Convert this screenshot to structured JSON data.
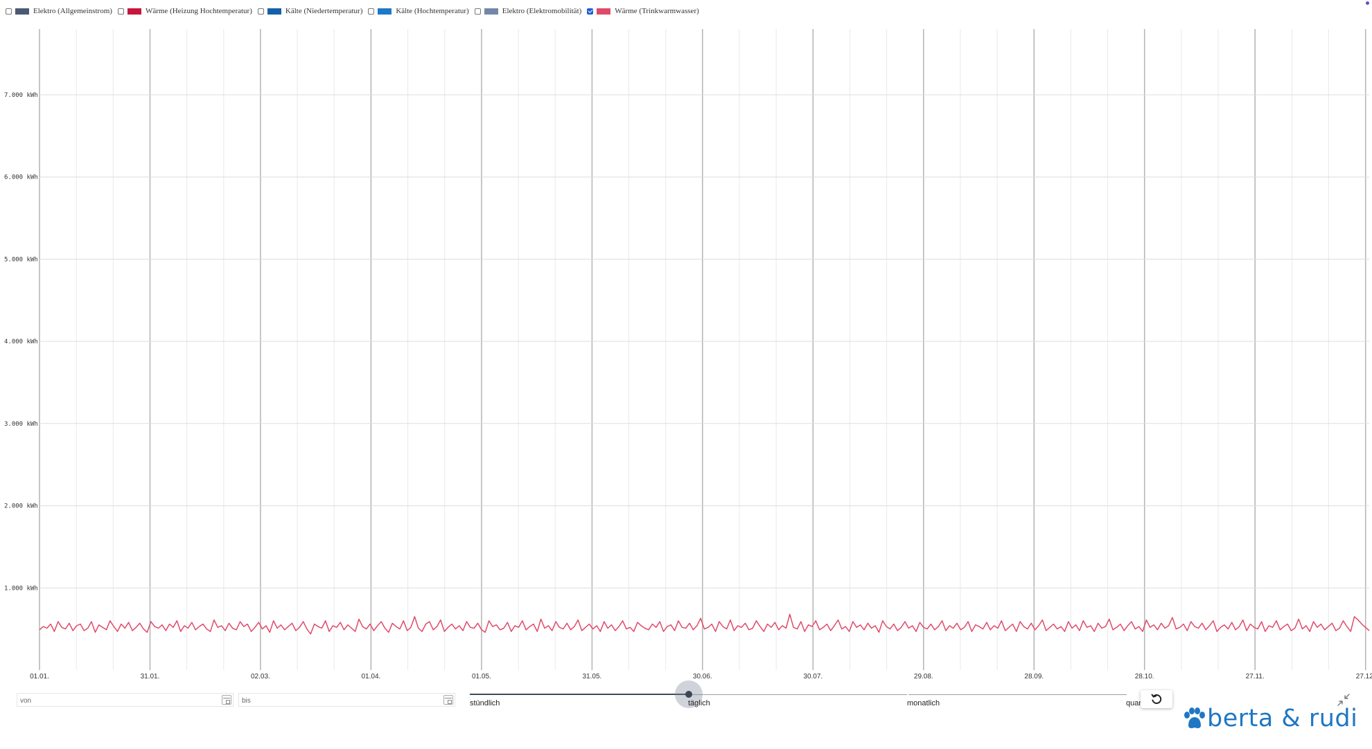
{
  "legend": {
    "items": [
      {
        "label": "Elektro (Allgemeinstrom)",
        "color": "#4a5a75",
        "checked": false
      },
      {
        "label": "Wärme (Heizung Hochtemperatur)",
        "color": "#c8153a",
        "checked": false
      },
      {
        "label": "Kälte (Niedertemperatur)",
        "color": "#1460a8",
        "checked": false
      },
      {
        "label": "Kälte (Hochtemperatur)",
        "color": "#1e78c8",
        "checked": false
      },
      {
        "label": "Elektro (Elektromobilität)",
        "color": "#7388a8",
        "checked": false
      },
      {
        "label": "Wärme (Trinkwarmwasser)",
        "color": "#e04a68",
        "checked": true
      }
    ]
  },
  "chart_data": {
    "type": "line",
    "ylim": [
      0,
      7800
    ],
    "y_ticks": [
      1000,
      2000,
      3000,
      4000,
      5000,
      6000,
      7000
    ],
    "y_tick_labels": [
      "1.000 kWh",
      "2.000 kWh",
      "3.000 kWh",
      "4.000 kWh",
      "5.000 kWh",
      "6.000 kWh",
      "7.000 kWh"
    ],
    "x_range_days": [
      0,
      361
    ],
    "x_ticks": [
      0,
      30,
      60,
      90,
      120,
      150,
      180,
      210,
      240,
      270,
      300,
      330,
      360
    ],
    "x_tick_labels": [
      "01.01.",
      "31.01.",
      "02.03.",
      "01.04.",
      "01.05.",
      "31.05.",
      "30.06.",
      "30.07.",
      "29.08.",
      "28.09.",
      "28.10.",
      "27.11.",
      "27.12."
    ],
    "grid": true,
    "series": [
      {
        "name": "Wärme (Trinkwarmwasser)",
        "color": "#e04a68",
        "values": [
          490,
          530,
          510,
          560,
          470,
          590,
          520,
          500,
          570,
          480,
          540,
          560,
          480,
          510,
          590,
          460,
          550,
          520,
          490,
          600,
          530,
          470,
          560,
          510,
          580,
          480,
          520,
          570,
          500,
          460,
          590,
          530,
          510,
          550,
          480,
          560,
          520,
          600,
          470,
          540,
          510,
          580,
          490,
          530,
          560,
          500,
          470,
          610,
          520,
          540,
          480,
          570,
          510,
          490,
          590,
          530,
          560,
          470,
          520,
          580,
          500,
          540,
          460,
          600,
          510,
          550,
          490,
          530,
          570,
          480,
          520,
          590,
          500,
          440,
          560,
          530,
          510,
          600,
          470,
          540,
          520,
          580,
          490,
          550,
          510,
          470,
          620,
          530,
          500,
          560,
          480,
          540,
          590,
          510,
          460,
          570,
          530,
          500,
          600,
          480,
          520,
          650,
          510,
          470,
          560,
          590,
          490,
          530,
          610,
          470,
          520,
          560,
          500,
          540,
          480,
          590,
          520,
          510,
          570,
          490,
          460,
          600,
          530,
          550,
          490,
          510,
          580,
          470,
          540,
          520,
          600,
          490,
          530,
          560,
          470,
          620,
          510,
          540,
          480,
          590,
          520,
          500,
          570,
          490,
          530,
          610,
          480,
          520,
          560,
          500,
          540,
          470,
          590,
          510,
          550,
          480,
          530,
          600,
          500,
          520,
          470,
          580,
          540,
          510,
          490,
          560,
          520,
          590,
          470,
          530,
          550,
          480,
          600,
          520,
          510,
          570,
          490,
          540,
          630,
          500,
          520,
          560,
          470,
          590,
          530,
          500,
          610,
          480,
          540,
          520,
          570,
          490,
          510,
          600,
          530,
          470,
          560,
          520,
          580,
          490,
          540,
          510,
          680,
          520,
          500,
          590,
          470,
          550,
          530,
          600,
          490,
          520,
          560,
          480,
          540,
          610,
          500,
          530,
          470,
          590,
          520,
          550,
          490,
          570,
          510,
          540,
          460,
          600,
          530,
          500,
          560,
          480,
          520,
          590,
          510,
          540,
          470,
          580,
          520,
          500,
          560,
          490,
          530,
          600,
          480,
          540,
          510,
          570,
          490,
          520,
          590,
          470,
          550,
          530,
          500,
          580,
          490,
          540,
          510,
          600,
          480,
          520,
          560,
          470,
          590,
          530,
          500,
          570,
          490,
          540,
          610,
          480,
          520,
          560,
          500,
          530,
          470,
          590,
          510,
          550,
          480,
          600,
          520,
          540,
          470,
          570,
          510,
          530,
          620,
          490,
          520,
          560,
          480,
          540,
          590,
          500,
          530,
          470,
          610,
          520,
          550,
          490,
          570,
          510,
          540,
          640,
          500,
          520,
          560,
          480,
          590,
          530,
          510,
          570,
          490,
          540,
          600,
          470,
          520,
          550,
          500,
          580,
          490,
          530,
          610,
          480,
          560,
          520,
          500,
          590,
          470,
          540,
          520,
          600,
          490,
          530,
          560,
          480,
          510,
          620,
          500,
          540,
          470,
          590,
          520,
          560,
          490,
          530,
          570,
          480,
          510,
          600,
          530,
          470,
          650,
          610,
          560,
          520,
          480
        ]
      }
    ]
  },
  "controls": {
    "from_placeholder": "von",
    "to_placeholder": "bis",
    "resolution_options": [
      "stündlich",
      "täglich",
      "monatlich",
      "quar"
    ],
    "selected_resolution": "täglich"
  },
  "brand": {
    "name": "berta & rudi",
    "color": "#1f77c4"
  }
}
